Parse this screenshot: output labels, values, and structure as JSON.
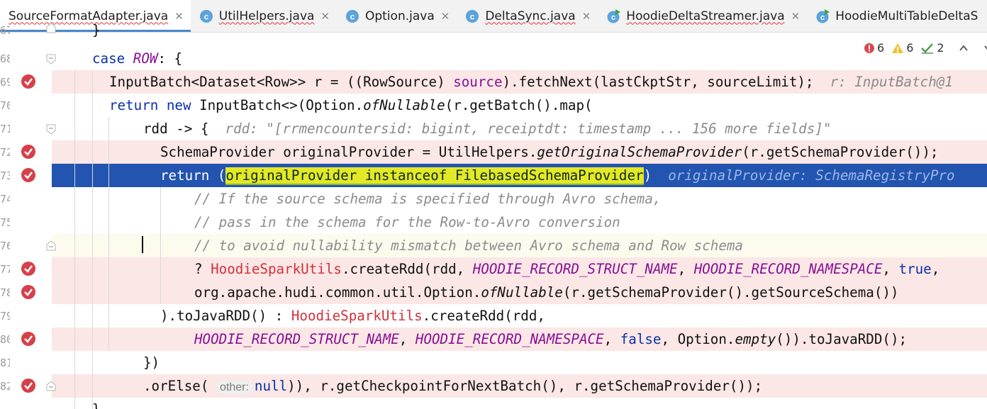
{
  "tabs": [
    {
      "label": "SourceFormatAdapter.java",
      "active": true
    },
    {
      "label": "UtilHelpers.java"
    },
    {
      "label": "Option.java"
    },
    {
      "label": "DeltaSync.java"
    },
    {
      "label": "HoodieDeltaStreamer.java"
    },
    {
      "label": "HoodieMultiTableDeltaS"
    }
  ],
  "inspections": {
    "errors": "6",
    "warnings": "6",
    "weak_warnings": "2"
  },
  "line_numbers": [
    "67",
    "68",
    "69",
    "70",
    "71",
    "72",
    "73",
    "74",
    "75",
    "76",
    "77",
    "78",
    "79",
    "80",
    "81",
    "82"
  ],
  "code": {
    "l0": "}",
    "l1": {
      "kw": "case",
      "fld": "ROW",
      "rest": ": {"
    },
    "l2": {
      "a": "InputBatch<Dataset<Row>> r = ((RowSource) ",
      "fld": "source",
      "b": ").fetchNext(lastCkptStr, sourceLimit);",
      "hint": "r: InputBatch@1"
    },
    "l3": {
      "kw1": "return",
      "kw2": "new",
      "a": " InputBatch<>(Option.",
      "it": "ofNullable",
      "b": "(r.getBatch().map("
    },
    "l4": {
      "a": "rdd -> {",
      "hint": "rdd: \"[rrmencountersid: bigint, receiptdt: timestamp ... 156 more fields]\""
    },
    "l5": {
      "a": "SchemaProvider originalProvider = UtilHelpers.",
      "it": "getOriginalSchemaProvider",
      "b": "(r.getSchemaProvider());"
    },
    "l6": {
      "kw": "return",
      "p1": " (",
      "hl": "originalProvider instanceof FilebasedSchemaProvider",
      "p2": ")",
      "hint": "originalProvider: SchemaRegistryPro"
    },
    "l7": "// If the source schema is specified through Avro schema,",
    "l8": "// pass in the schema for the Row-to-Avro conversion",
    "l9": "// to avoid nullability mismatch between Avro schema and Row schema",
    "l10": {
      "a": "? ",
      "red": "HoodieSparkUtils",
      "b": ".createRdd(rdd, ",
      "f1": "HOODIE_RECORD_STRUCT_NAME",
      "c": ", ",
      "f2": "HOODIE_RECORD_NAMESPACE",
      "d": ", ",
      "kw": "true",
      "e": ","
    },
    "l11": {
      "a": "org.apache.hudi.common.util.Option.",
      "it": "ofNullable",
      "b": "(r.getSchemaProvider().getSourceSchema())"
    },
    "l12": {
      "a": ").toJavaRDD() : ",
      "red": "HoodieSparkUtils",
      "b": ".createRdd(rdd,"
    },
    "l13": {
      "f1": "HOODIE_RECORD_STRUCT_NAME",
      "a": ", ",
      "f2": "HOODIE_RECORD_NAMESPACE",
      "b": ", ",
      "kw": "false",
      "c": ", Option.",
      "it": "empty",
      "d": "()).toJavaRDD();"
    },
    "l14": "})",
    "l15": {
      "a": ".orElse(",
      "param": "other:",
      "kw": "null",
      "b": ")), r.getCheckpointForNextBatch(), r.getSchemaProvider());"
    },
    "l16": "}"
  },
  "colors": {
    "keyword": "#0a31a8",
    "field": "#871094",
    "comment": "#8c8c8c",
    "selection": "#2254b0",
    "highlight": "#e3e827",
    "breakpoint": "#d6404a",
    "breakpoint_line": "#fae7e6",
    "tab_indicator": "#4a88c7"
  }
}
